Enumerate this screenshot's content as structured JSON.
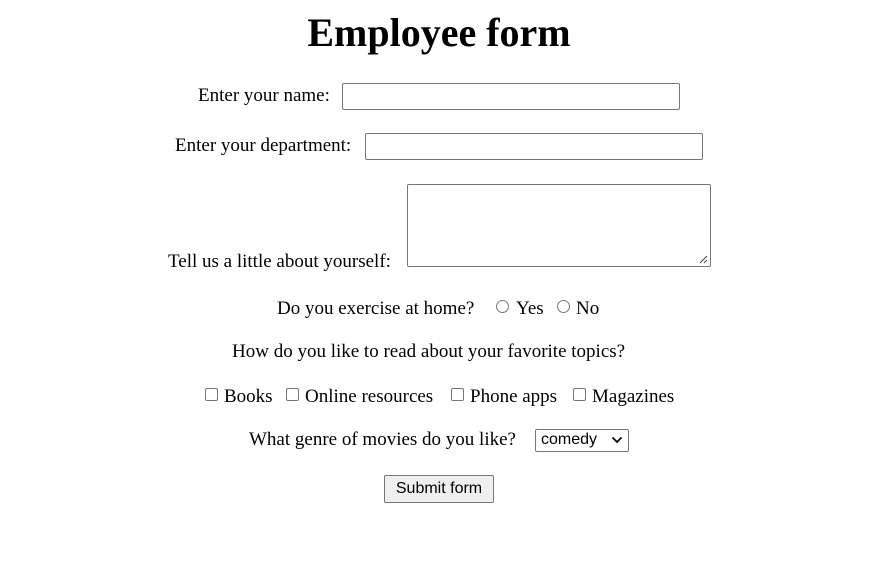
{
  "page": {
    "title": "Employee form"
  },
  "form": {
    "name_label": "Enter your name:",
    "name_value": "",
    "department_label": "Enter your department:",
    "department_value": "",
    "about_label": "Tell us a little about yourself:",
    "about_value": "",
    "exercise_question": "Do you exercise at home?",
    "exercise_options": [
      {
        "label": "Yes",
        "selected": false
      },
      {
        "label": "No",
        "selected": false
      }
    ],
    "reading_question": "How do you like to read about your favorite topics?",
    "reading_options": [
      {
        "label": "Books",
        "checked": false
      },
      {
        "label": "Online resources",
        "checked": false
      },
      {
        "label": "Phone apps",
        "checked": false
      },
      {
        "label": "Magazines",
        "checked": false
      }
    ],
    "genre_label": "What genre of movies do you like?",
    "genre_selected": "comedy",
    "submit_label": "Submit form"
  },
  "icons": {
    "resize_grip": "resize-grip-icon",
    "select_chevron": "chevron-down-icon"
  }
}
